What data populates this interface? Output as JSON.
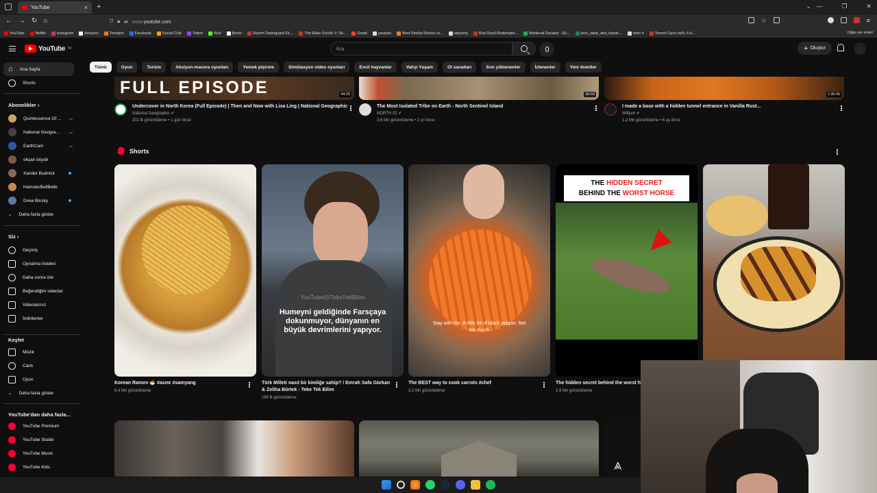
{
  "browser": {
    "tab_title": "YouTube",
    "url_host": "www.",
    "url_domain": "youtube.com",
    "bookmarks": [
      {
        "label": "YouTube",
        "color": "#ff0000"
      },
      {
        "label": "Netflix",
        "color": "#e50914"
      },
      {
        "label": "Instagram",
        "color": "#c13584"
      },
      {
        "label": "Amazon",
        "color": "#ffffff"
      },
      {
        "label": "Trendyol",
        "color": "#f27a1a"
      },
      {
        "label": "Facebook",
        "color": "#1877f2"
      },
      {
        "label": "Social Club",
        "color": "#f0a800"
      },
      {
        "label": "Twitch",
        "color": "#9146ff"
      },
      {
        "label": "Kick",
        "color": "#53fc18"
      },
      {
        "label": "Botrix",
        "color": "#ffffff"
      },
      {
        "label": "Skyrim Dawnguard DL...",
        "color": "#c0392b"
      },
      {
        "label": "The Elder Scrolls V: Sk...",
        "color": "#c0392b"
      },
      {
        "label": "Gmail",
        "color": "#ea4335"
      },
      {
        "label": "youtube",
        "color": "#dddddd"
      },
      {
        "label": "Best Similar Movies re...",
        "color": "#e67e22"
      },
      {
        "label": "akşveriş",
        "color": "#dddddd"
      },
      {
        "label": "Red Dead Redemptio...",
        "color": "#c0392b"
      },
      {
        "label": "Medieval Dynasty - Ek...",
        "color": "#27ae60"
      },
      {
        "label": "borc_takip_afet_hasan...",
        "color": "#1e8449"
      },
      {
        "label": "sims 4",
        "color": "#dddddd"
      },
      {
        "label": "Torrent Oyun indir, Ful...",
        "color": "#c0392b"
      }
    ],
    "bookmarks_other": "Diğer yer imleri"
  },
  "header": {
    "logo_text": "YouTube",
    "logo_sup": "TR",
    "search_placeholder": "Ara",
    "create_label": "Oluştur"
  },
  "chips": [
    "Tümü",
    "Oyun",
    "Turizm",
    "Aksiyon-macera oyunları",
    "Yemek pişirme",
    "Simülasyon video oyunları",
    "Evcil hayvanlar",
    "Vahşi Yaşam",
    "Ol sanatları",
    "Son yüklenenler",
    "İzlenenler",
    "Yeni öneriler"
  ],
  "sidebar": {
    "main": [
      {
        "label": "Ana Sayfa",
        "icon": "home-icon"
      },
      {
        "label": "Shorts",
        "icon": "shorts-icon"
      }
    ],
    "subscriptions_title": "Abonelikler",
    "subscriptions": [
      {
        "label": "Quintessence Of ...",
        "color": "#c8a36a"
      },
      {
        "label": "National Geogra...",
        "color": "#444444"
      },
      {
        "label": "EarthCam",
        "color": "#2a5aa0"
      },
      {
        "label": "okşan büyük",
        "color": "#7a5a4a"
      },
      {
        "label": "Xander Budnick",
        "color": "#8a6a5a"
      },
      {
        "label": "HamsterBellBelle",
        "color": "#c08a4a"
      },
      {
        "label": "Drew Binsky",
        "color": "#5a7aa0"
      }
    ],
    "show_more_1": "Daha fazla göster",
    "you_title": "Siz",
    "you_items": [
      {
        "label": "Geçmiş",
        "icon": "history-icon"
      },
      {
        "label": "Oynatma listeleri",
        "icon": "playlist-icon"
      },
      {
        "label": "Daha sonra izle",
        "icon": "clock-icon"
      },
      {
        "label": "Beğendiğim videolar",
        "icon": "like-icon"
      },
      {
        "label": "Videolarınız",
        "icon": "play-icon"
      },
      {
        "label": "İndirilenler",
        "icon": "download-icon"
      }
    ],
    "explore_title": "Keşfet",
    "explore_items": [
      {
        "label": "Müzik",
        "icon": "music-icon"
      },
      {
        "label": "Canlı",
        "icon": "live-icon"
      },
      {
        "label": "Oyun",
        "icon": "gamepad-icon"
      }
    ],
    "show_more_2": "Daha fazla göster",
    "more_title": "YouTube'dan daha fazla...",
    "more_items": [
      {
        "label": "YouTube Premium"
      },
      {
        "label": "YouTube Studio"
      },
      {
        "label": "YouTube Music"
      },
      {
        "label": "YouTube Kids"
      }
    ]
  },
  "videos": [
    {
      "title": "Undercover in North Korea (Full Episode) | Then and Now with Lisa Ling | National Geographic",
      "channel": "National Geographic",
      "stats": "201 B görüntüleme • 1 gün önce",
      "duration": "44:25",
      "overlay": "FULL EPISODE"
    },
    {
      "title": "The Most Isolated Tribe on Earth - North Sentinel Island",
      "channel": "NORTH 02",
      "stats": "3,6 Mn görüntüleme • 2 yıl önce",
      "duration": "39:59"
    },
    {
      "title": "I made a base with a hidden tunnel entrance in Vanilla Rust...",
      "channel": "Willjum",
      "stats": "1,2 Mn görüntüleme • 6 ay önce",
      "duration": "1:36:05"
    }
  ],
  "shorts": {
    "title": "Shorts",
    "items": [
      {
        "title": "Korean Ramen 🍜 #asmr #samyang",
        "stats": "6,4 Mn görüntüleme"
      },
      {
        "title": "Türk Milleti nasıl bir kimliğe sahip? / Emrah Safa Gürkan & Zeliha Bürtek - Teke Tek Bilim",
        "stats": "166 B görüntüleme",
        "caption": "Humeyni geldiğinde Farsçaya dokunmuyor, dünyanın en büyük devrimlerini yapıyor.",
        "watermark": "YouTube/@TekeTekBilim"
      },
      {
        "title": "The BEST way to cook carrots  #chef",
        "stats": "2,2 Mn görüntüleme",
        "caption": "Stay with me. A little bit of black pepper. Not too much."
      },
      {
        "title": "The hidden secret behind the worst horse #story",
        "stats": "1,9 Mn görüntüleme",
        "caption_a": "THE ",
        "caption_b": "HIDDEN SECRET",
        "caption_c": "BEHIND THE ",
        "caption_d": "WORST HORSE"
      },
      {
        "title": "",
        "stats": ""
      }
    ]
  }
}
